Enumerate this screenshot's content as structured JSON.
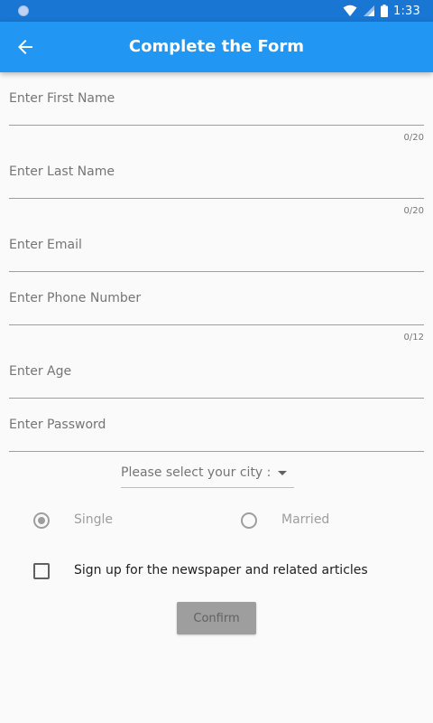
{
  "status_bar": {
    "time": "1:33"
  },
  "app_bar": {
    "title": "Complete the Form"
  },
  "form": {
    "first_name": {
      "placeholder": "Enter First Name",
      "counter": "0/20"
    },
    "last_name": {
      "placeholder": "Enter Last Name",
      "counter": "0/20"
    },
    "email": {
      "placeholder": "Enter Email"
    },
    "phone": {
      "placeholder": "Enter Phone Number",
      "counter": "0/12"
    },
    "age": {
      "placeholder": "Enter Age"
    },
    "password": {
      "placeholder": "Enter Password"
    },
    "city": {
      "label": "Please select your city :"
    },
    "marital_status": {
      "options": [
        {
          "label": "Single",
          "selected": true
        },
        {
          "label": "Married",
          "selected": false
        }
      ]
    },
    "newsletter": {
      "label": "Sign up for the newspaper and related articles",
      "checked": false
    },
    "confirm_label": "Confirm"
  },
  "colors": {
    "primary": "#2196f3",
    "primary_dark": "#1976d2",
    "disabled": "#9e9e9e"
  }
}
